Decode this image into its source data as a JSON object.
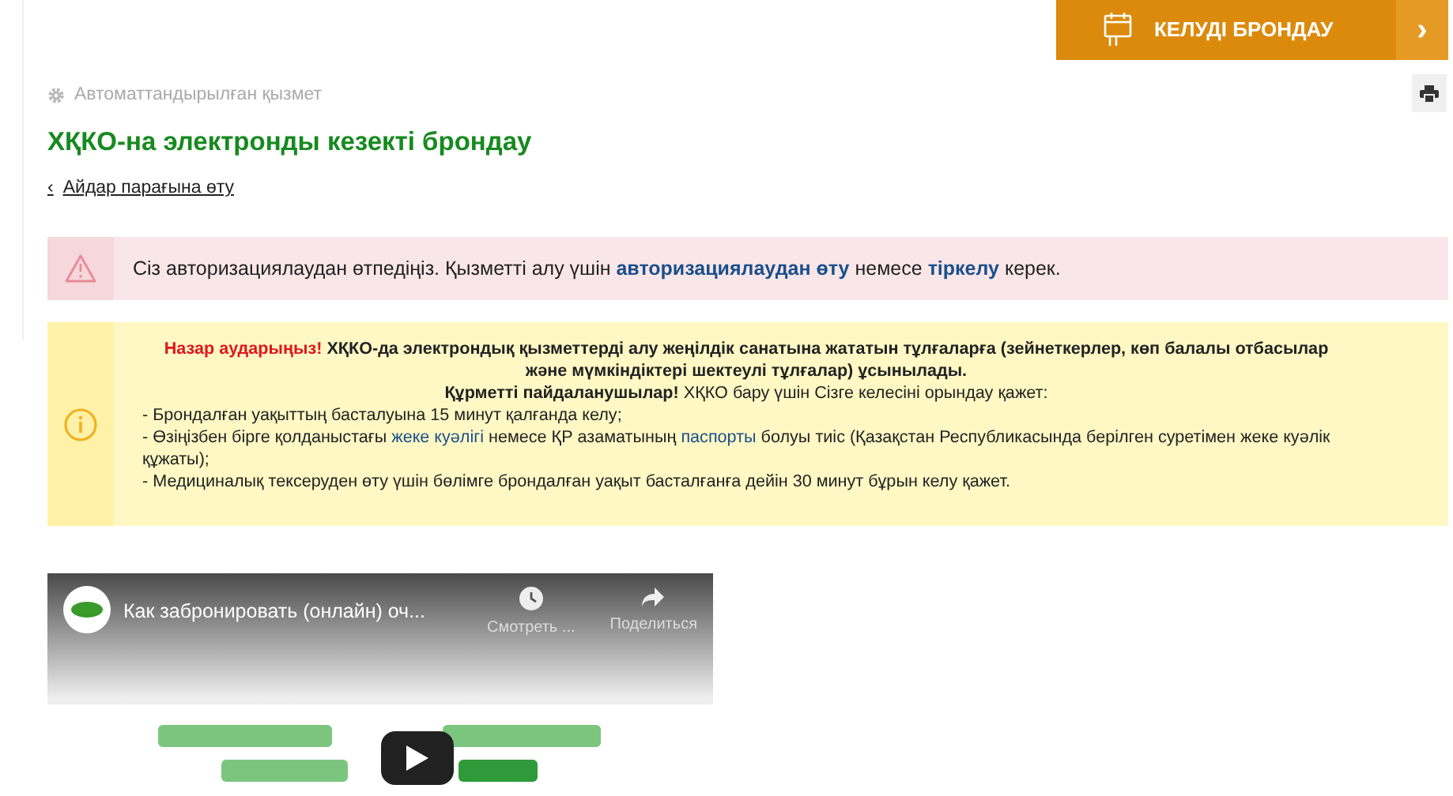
{
  "booking_button": {
    "label": "КЕЛУДІ БРОНДАУ",
    "arrow": "›"
  },
  "service_type": "Автоматтандырылған қызмет",
  "title": "ХҚКО-на электронды кезекті брондау",
  "back_link": {
    "arrow": "‹",
    "label": "Айдар парағына өту"
  },
  "auth_alert": {
    "parts": [
      {
        "text": "Сіз авторизациялаудан өтпедіңіз. Қызметті алу үшін ",
        "kind": "plain"
      },
      {
        "text": "авторизациялаудан өту",
        "kind": "link"
      },
      {
        "text": " немесе ",
        "kind": "plain"
      },
      {
        "text": "тіркелу",
        "kind": "link"
      },
      {
        "text": " керек.",
        "kind": "plain"
      }
    ]
  },
  "notice": {
    "lines": [
      {
        "kind": "center",
        "parts": [
          {
            "text": "Назар аударыңыз!",
            "kind": "alert"
          },
          {
            "text": "  ХҚКО-да электрондық қызметтерді алу жеңілдік санатына жататын тұлғаларға (зейнеткерлер, көп балалы отбасылар және мүмкіндіктері шектеулі тұлғалар) ұсынылады.",
            "kind": "bold"
          }
        ]
      },
      {
        "kind": "center",
        "parts": [
          {
            "text": "Құрметті пайдаланушылар!",
            "kind": "bold"
          },
          {
            "text": "  ХҚКО бару үшін Сізге келесіні орындау қажет:",
            "kind": "plain"
          }
        ]
      },
      {
        "kind": "item",
        "parts": [
          {
            "text": "- Брондалған уақыттың басталуына 15 минут қалғанда келу;",
            "kind": "plain"
          }
        ]
      },
      {
        "kind": "item",
        "parts": [
          {
            "text": "- Өзіңізбен бірге қолданыстағы ",
            "kind": "plain"
          },
          {
            "text": "жеке куәлігі",
            "kind": "link"
          },
          {
            "text": " немесе ҚР азаматының ",
            "kind": "plain"
          },
          {
            "text": "паспорты",
            "kind": "link"
          },
          {
            "text": " болуы тиіс (Қазақстан Республикасында берілген суретімен жеке куәлік құжаты);",
            "kind": "plain"
          }
        ]
      },
      {
        "kind": "item",
        "parts": [
          {
            "text": "- Медициналық тексеруден өту үшін бөлімге брондалған уақыт басталғанға дейін 30 минут бұрын келу қажет.",
            "kind": "plain"
          }
        ]
      }
    ]
  },
  "video": {
    "title": "Как забронировать (онлайн) оч...",
    "watch_later": "Смотреть ...",
    "share": "Поделиться"
  }
}
